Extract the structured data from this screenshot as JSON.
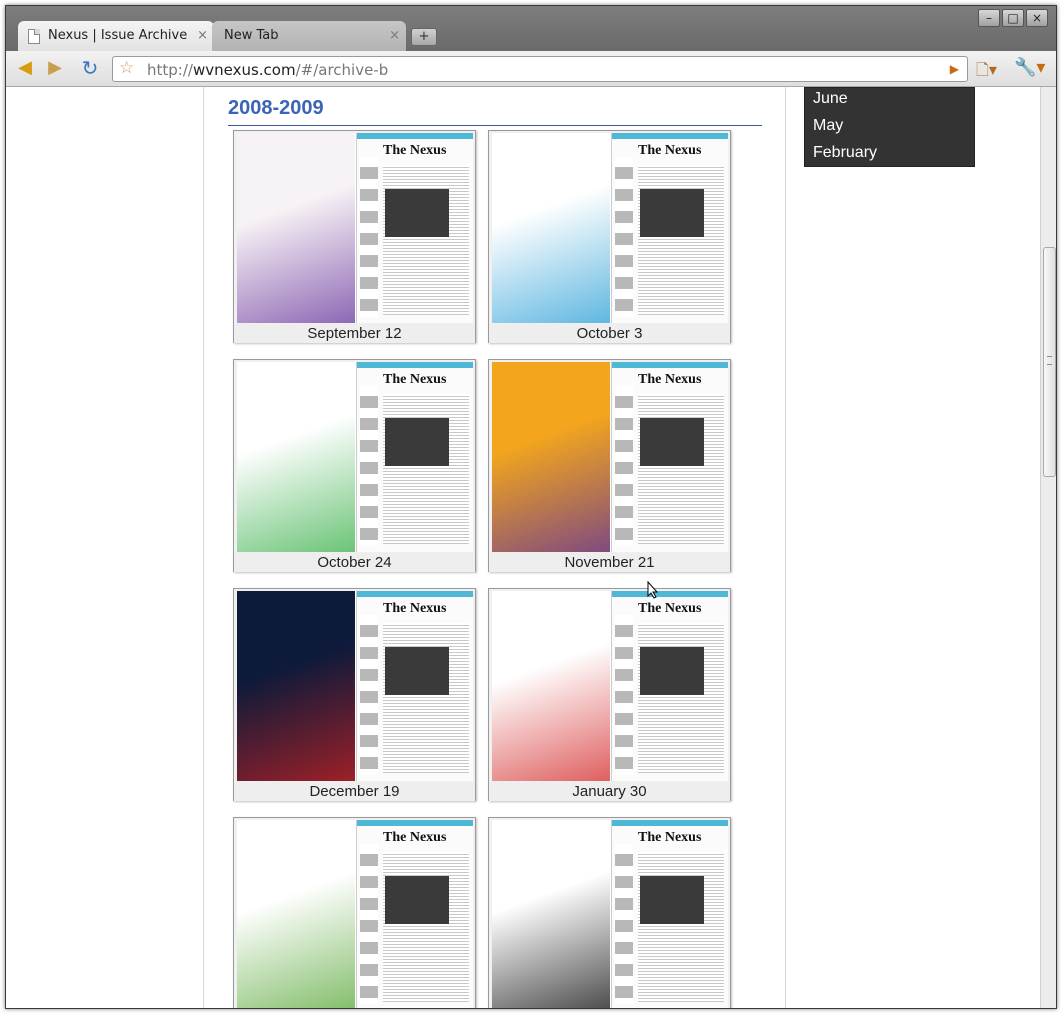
{
  "browser": {
    "tabs": [
      {
        "title": "Nexus | Issue Archive",
        "close": "×",
        "active": true
      },
      {
        "title": "New Tab",
        "close": "×",
        "active": false
      }
    ],
    "new_tab_label": "+",
    "window_controls": {
      "minimize": "–",
      "maximize": "□",
      "close": "×"
    },
    "nav": {
      "back_icon": "arrow-left",
      "forward_icon": "arrow-right",
      "reload_icon": "reload",
      "back_glyph": "◀",
      "forward_glyph": "▶",
      "reload_glyph": "↻"
    },
    "url": {
      "scheme": "http://",
      "host": "wvnexus.com",
      "path": "/#/archive-b"
    },
    "star_glyph": "☆",
    "go_glyph": "▶",
    "page_menu_glyph": "🗋▾",
    "wrench_glyph": "🔧▾"
  },
  "archive": {
    "year_heading": "2008-2009",
    "issues": [
      {
        "label": "September 12",
        "left_color": "#f7f2f5",
        "accent": "#6b3aa0"
      },
      {
        "label": "October 3",
        "left_color": "#ffffff",
        "accent": "#2a9fd6"
      },
      {
        "label": "October 24",
        "left_color": "#ffffff",
        "accent": "#3ab04a"
      },
      {
        "label": "November 21",
        "left_color": "#f2a51d",
        "accent": "#5a2ca0"
      },
      {
        "label": "December 19",
        "left_color": "#0d1a3a",
        "accent": "#c22"
      },
      {
        "label": "January 30",
        "left_color": "#ffffff",
        "accent": "#d42a2a"
      },
      {
        "label": "",
        "left_color": "#ffffff",
        "accent": "#5aa83a"
      },
      {
        "label": "",
        "left_color": "#ffffff",
        "accent": "#111111"
      }
    ],
    "cover_masthead": "The Nexus"
  },
  "month_menu": {
    "items": [
      "June",
      "May",
      "February"
    ]
  },
  "colors": {
    "heading": "#3b64b7",
    "menu_bg": "#333333"
  }
}
